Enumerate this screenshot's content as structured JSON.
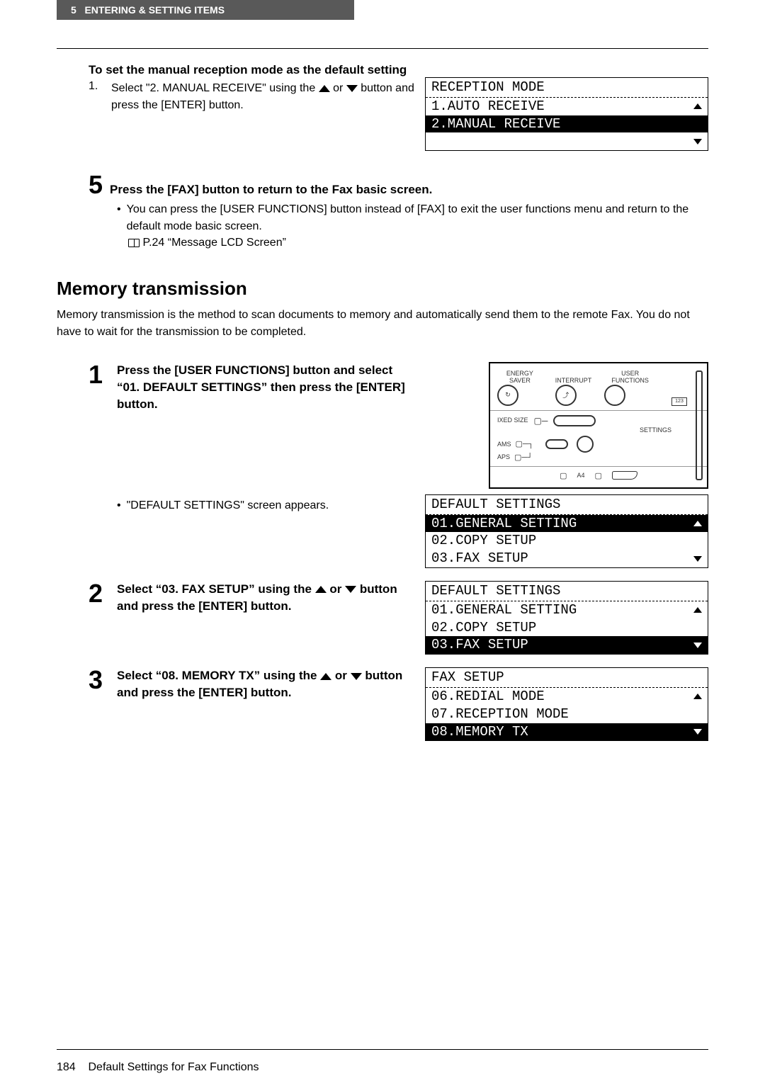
{
  "header": {
    "chapter_num": "5",
    "chapter_title": "ENTERING & SETTING ITEMS"
  },
  "sec1": {
    "title": "To set the manual reception mode as the default setting",
    "item1_num": "1.",
    "item1_text_a": "Select \"2. MANUAL RECEIVE\" using the ",
    "item1_text_b": " or ",
    "item1_text_c": " button and press the [ENTER] button."
  },
  "lcd1": {
    "title": "RECEPTION MODE",
    "r1": "1.AUTO RECEIVE",
    "r2": "2.MANUAL RECEIVE"
  },
  "step5": {
    "num": "5",
    "title": "Press the [FAX] button to return to the Fax basic screen.",
    "bullet": "You can press the [USER FUNCTIONS] button instead of [FAX] to exit the user functions menu and return to the default mode basic screen.",
    "ref": "P.24 “Message LCD Screen”"
  },
  "section2": {
    "title": "Memory transmission",
    "para": "Memory transmission is the method to scan documents to memory and automatically send them to the remote Fax. You do not have to wait for the transmission to be completed."
  },
  "panel": {
    "energy_saver": "ENERGY SAVER",
    "interrupt": "INTERRUPT",
    "user_functions": "USER FUNCTIONS",
    "ixed_size": "IXED SIZE",
    "ams": "AMS",
    "aps": "APS",
    "settings": "SETTINGS",
    "a4": "A4"
  },
  "s1": {
    "num": "1",
    "bold": "Press the [USER FUNCTIONS] button and select “01. DEFAULT SETTINGS” then press the [ENTER] button.",
    "bullet": "\"DEFAULT SETTINGS\" screen appears."
  },
  "lcd2": {
    "title": "DEFAULT SETTINGS",
    "r1": "01.GENERAL SETTING",
    "r2": "02.COPY SETUP",
    "r3": "03.FAX SETUP"
  },
  "s2": {
    "num": "2",
    "bold_a": "Select “03. FAX SETUP” using the ",
    "bold_b": " or ",
    "bold_c": " button and press the [ENTER] button."
  },
  "lcd3": {
    "title": "DEFAULT SETTINGS",
    "r1": "01.GENERAL SETTING",
    "r2": "02.COPY SETUP",
    "r3": "03.FAX SETUP"
  },
  "s3": {
    "num": "3",
    "bold_a": "Select “08. MEMORY TX” using the ",
    "bold_b": " or ",
    "bold_c": " button and press the [ENTER] button."
  },
  "lcd4": {
    "title": "FAX SETUP",
    "r1": "06.REDIAL MODE",
    "r2": "07.RECEPTION MODE",
    "r3": "08.MEMORY TX"
  },
  "footer": {
    "page": "184",
    "title": "Default Settings for Fax Functions"
  }
}
